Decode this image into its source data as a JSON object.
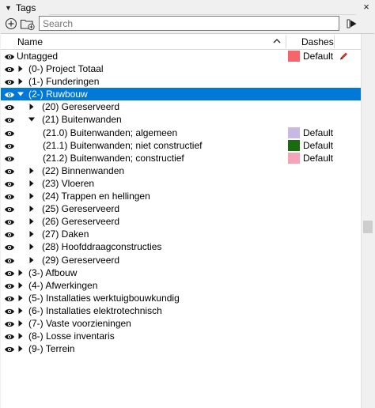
{
  "panel": {
    "title": "Tags",
    "collapse_glyph": "▼",
    "close_glyph": "×"
  },
  "toolbar": {
    "add_tag_icon": "plus-circle-icon",
    "add_folder_icon": "folder-add-icon",
    "search_placeholder": "Search",
    "details_icon": "details-arrow-icon"
  },
  "columns": {
    "name": "Name",
    "sort_glyph": "⌃",
    "dashes": "Dashes"
  },
  "colors": {
    "selected_bg": "#0078d7",
    "untagged_swatch": "#f4666a",
    "swatch_210": "#c8b8e4",
    "swatch_211": "#1a6b0f",
    "swatch_212": "#f4a3bb"
  },
  "rows": [
    {
      "label": "Untagged",
      "indent": 0,
      "expander": "",
      "swatch": "#f4666a",
      "dashes": "Default",
      "pencil": true
    },
    {
      "label": "(0-) Project Totaal",
      "indent": 0,
      "expander": "collapsed"
    },
    {
      "label": "(1-) Funderingen",
      "indent": 0,
      "expander": "collapsed"
    },
    {
      "label": "(2-) Ruwbouw",
      "indent": 0,
      "expander": "expanded",
      "selected": true
    },
    {
      "label": "(20) Gereserveerd",
      "indent": 1,
      "expander": "collapsed"
    },
    {
      "label": "(21) Buitenwanden",
      "indent": 1,
      "expander": "expanded"
    },
    {
      "label": "(21.0) Buitenwanden; algemeen",
      "indent": 2,
      "expander": "",
      "swatch": "#c8b8e4",
      "dashes": "Default"
    },
    {
      "label": "(21.1) Buitenwanden; niet constructief",
      "indent": 2,
      "expander": "",
      "swatch": "#1a6b0f",
      "dashes": "Default"
    },
    {
      "label": "(21.2) Buitenwanden; constructief",
      "indent": 2,
      "expander": "",
      "swatch": "#f4a3bb",
      "dashes": "Default"
    },
    {
      "label": "(22) Binnenwanden",
      "indent": 1,
      "expander": "collapsed"
    },
    {
      "label": "(23) Vloeren",
      "indent": 1,
      "expander": "collapsed"
    },
    {
      "label": "(24) Trappen en hellingen",
      "indent": 1,
      "expander": "collapsed"
    },
    {
      "label": "(25) Gereserveerd",
      "indent": 1,
      "expander": "collapsed"
    },
    {
      "label": "(26) Gereserveerd",
      "indent": 1,
      "expander": "collapsed"
    },
    {
      "label": "(27) Daken",
      "indent": 1,
      "expander": "collapsed"
    },
    {
      "label": "(28) Hoofddraagconstructies",
      "indent": 1,
      "expander": "collapsed"
    },
    {
      "label": "(29) Gereserveerd",
      "indent": 1,
      "expander": "collapsed"
    },
    {
      "label": "(3-) Afbouw",
      "indent": 0,
      "expander": "collapsed"
    },
    {
      "label": "(4-) Afwerkingen",
      "indent": 0,
      "expander": "collapsed"
    },
    {
      "label": "(5-) Installaties werktuigbouwkundig",
      "indent": 0,
      "expander": "collapsed"
    },
    {
      "label": "(6-) Installaties elektrotechnisch",
      "indent": 0,
      "expander": "collapsed"
    },
    {
      "label": "(7-) Vaste voorzieningen",
      "indent": 0,
      "expander": "collapsed"
    },
    {
      "label": "(8-) Losse inventaris",
      "indent": 0,
      "expander": "collapsed"
    },
    {
      "label": "(9-) Terrein",
      "indent": 0,
      "expander": "collapsed"
    }
  ]
}
